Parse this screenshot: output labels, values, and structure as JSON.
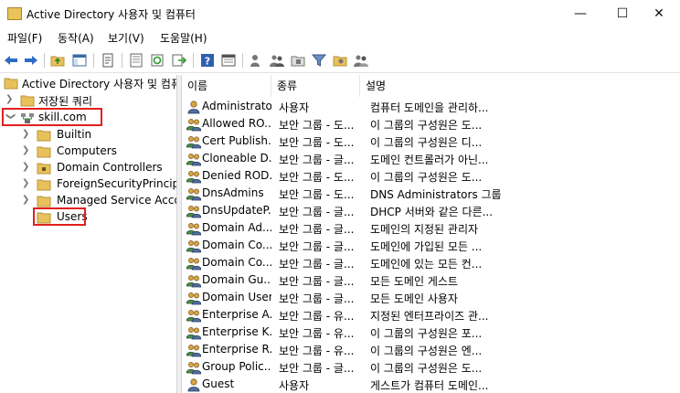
{
  "window": {
    "title": "Active Directory 사용자 및 컴퓨터",
    "min": "—",
    "max": "☐",
    "close": "✕"
  },
  "menu": [
    "파일(F)",
    "동작(A)",
    "보기(V)",
    "도움말(H)"
  ],
  "toolbar": [
    "back-arrow-icon",
    "forward-arrow-icon",
    "up-folder-icon",
    "show-console-tree-icon",
    "properties-icon",
    "export-list-icon",
    "refresh-icon",
    "export-icon",
    "help-icon",
    "view-icon",
    "add-user-icon",
    "add-group-icon",
    "add-ou-icon",
    "filter-icon",
    "add-to-group-icon",
    "delegate-icon"
  ],
  "tree": {
    "root": "Active Directory 사용자 및 컴퓨",
    "saved_queries": "저장된 쿼리",
    "domain": "skill.com",
    "children": [
      "Builtin",
      "Computers",
      "Domain Controllers",
      "ForeignSecurityPrincipal",
      "Managed Service Accou",
      "Users"
    ]
  },
  "list": {
    "columns": [
      "이름",
      "종류",
      "설명"
    ],
    "rows": [
      {
        "name": "Administrator",
        "type": "사용자",
        "desc": "컴퓨터 도메인을 관리하...",
        "icon": "user"
      },
      {
        "name": "Allowed RO...",
        "type": "보안 그룹 - 도...",
        "desc": "이 그룹의 구성원은 도...",
        "icon": "group"
      },
      {
        "name": "Cert Publish...",
        "type": "보안 그룹 - 도...",
        "desc": "이 그룹의 구성원은 디...",
        "icon": "group"
      },
      {
        "name": "Cloneable D...",
        "type": "보안 그룹 - 글...",
        "desc": "도메인 컨트롤러가 아닌...",
        "icon": "group"
      },
      {
        "name": "Denied ROD...",
        "type": "보안 그룹 - 도...",
        "desc": "이 그룹의 구성원은 도...",
        "icon": "group"
      },
      {
        "name": "DnsAdmins",
        "type": "보안 그룹 - 도...",
        "desc": "DNS Administrators 그룹",
        "icon": "group"
      },
      {
        "name": "DnsUpdateP...",
        "type": "보안 그룹 - 글...",
        "desc": "DHCP 서버와 같은 다른...",
        "icon": "group"
      },
      {
        "name": "Domain Ad...",
        "type": "보안 그룹 - 글...",
        "desc": "도메인의 지정된 관리자",
        "icon": "group"
      },
      {
        "name": "Domain Co...",
        "type": "보안 그룹 - 글...",
        "desc": "도메인에 가입된 모든 ...",
        "icon": "group"
      },
      {
        "name": "Domain Co...",
        "type": "보안 그룹 - 글...",
        "desc": "도메인에 있는 모든 컨...",
        "icon": "group"
      },
      {
        "name": "Domain Gu...",
        "type": "보안 그룹 - 글...",
        "desc": "모든 도메인 게스트",
        "icon": "group"
      },
      {
        "name": "Domain Users",
        "type": "보안 그룹 - 글...",
        "desc": "모든 도메인 사용자",
        "icon": "group"
      },
      {
        "name": "Enterprise A...",
        "type": "보안 그룹 - 유...",
        "desc": "지정된 엔터프라이즈 관...",
        "icon": "group"
      },
      {
        "name": "Enterprise K...",
        "type": "보안 그룹 - 유...",
        "desc": "이 그룹의 구성원은 포...",
        "icon": "group"
      },
      {
        "name": "Enterprise R...",
        "type": "보안 그룹 - 유...",
        "desc": "이 그룹의 구성원은 엔...",
        "icon": "group"
      },
      {
        "name": "Group Polic...",
        "type": "보안 그룹 - 글...",
        "desc": "이 그룹의 구성원은 도...",
        "icon": "group"
      },
      {
        "name": "Guest",
        "type": "사용자",
        "desc": "게스트가 컴퓨터 도메인...",
        "icon": "user"
      }
    ]
  },
  "colors": {
    "highlight": "#e0201f",
    "folder": "#e9c15a",
    "folder_dark": "#b8923a"
  }
}
